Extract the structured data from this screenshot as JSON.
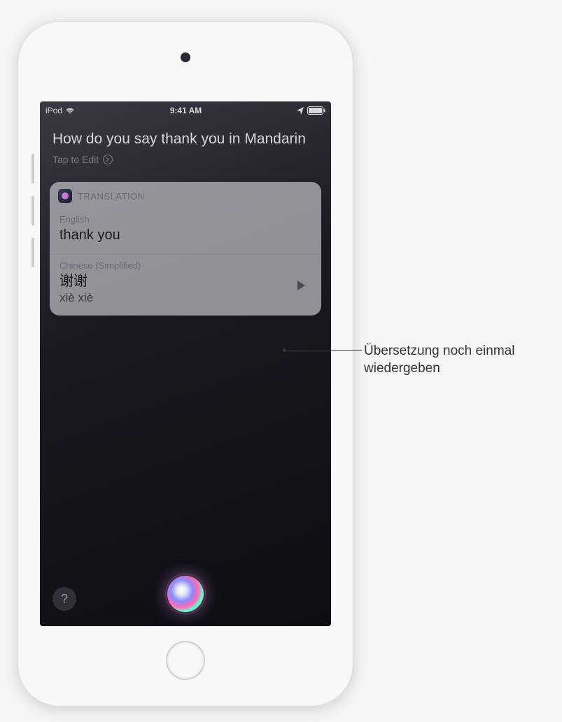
{
  "status": {
    "carrier": "iPod",
    "time": "9:41 AM"
  },
  "siri": {
    "query": "How do you say thank you in Mandarin",
    "tap_to_edit": "Tap to Edit"
  },
  "card": {
    "title": "TRANSLATION",
    "source": {
      "language": "English",
      "text": "thank you"
    },
    "target": {
      "language": "Chinese (Simplified)",
      "text": "谢谢",
      "romanization": "xiè xiè"
    }
  },
  "help_label": "?",
  "callout": {
    "text": "Übersetzung noch einmal wiedergeben"
  }
}
